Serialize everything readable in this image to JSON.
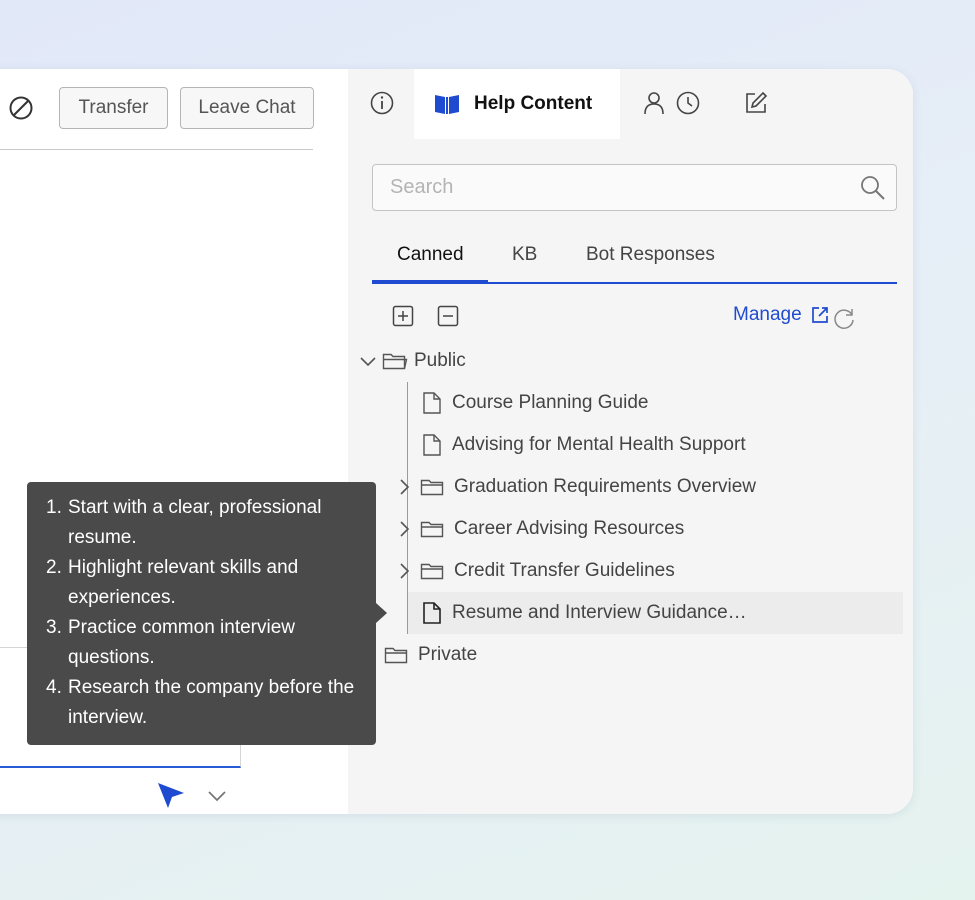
{
  "chat": {
    "transfer_label": "Transfer",
    "leave_label": "Leave Chat"
  },
  "help": {
    "active_tab_label": "Help Content",
    "tab_icons": [
      "info-icon",
      "book-icon",
      "person-icon",
      "clock-icon",
      "edit-icon"
    ],
    "search": {
      "placeholder": "Search",
      "value": ""
    },
    "subtabs": [
      "Canned",
      "KB",
      "Bot Responses"
    ],
    "active_subtab": "Canned",
    "manage_label": "Manage",
    "tree": {
      "public_label": "Public",
      "public_children": [
        {
          "label": "Course Planning Guide",
          "type": "file"
        },
        {
          "label": "Advising for Mental Health Support",
          "type": "file"
        },
        {
          "label": "Graduation Requirements Overview",
          "type": "folder"
        },
        {
          "label": "Career Advising Resources",
          "type": "folder"
        },
        {
          "label": "Credit Transfer Guidelines",
          "type": "folder"
        },
        {
          "label": "Resume and Interview Guidance…",
          "type": "file",
          "selected": true
        }
      ],
      "private_label": "Private"
    }
  },
  "tooltip": {
    "items": [
      {
        "num": "1.",
        "text": "Start with a clear, professional resume."
      },
      {
        "num": "2.",
        "text": "Highlight relevant skills and experiences."
      },
      {
        "num": "3.",
        "text": "Practice common interview questions."
      },
      {
        "num": "4.",
        "text": "Research the company before the interview."
      }
    ]
  },
  "colors": {
    "accent": "#1f4bd0",
    "tooltip_bg": "#4a4a4a",
    "pane_bg": "#f5f5f5"
  }
}
